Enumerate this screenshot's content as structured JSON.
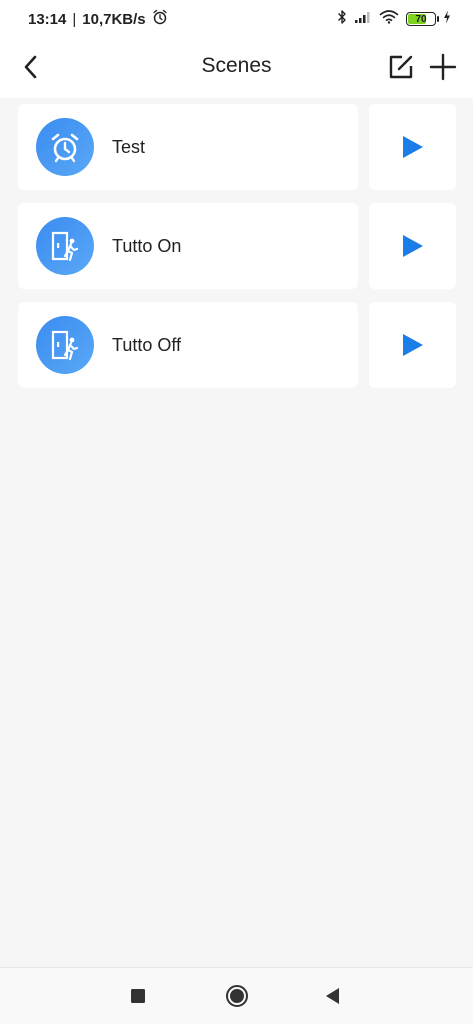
{
  "status_bar": {
    "time": "13:14",
    "separator": "|",
    "speed": "10,7KB/s",
    "battery_level": "70",
    "battery_fraction": 0.7,
    "icons": [
      "alarm-icon",
      "bluetooth-icon",
      "signal-icon",
      "wifi-icon",
      "battery-icon",
      "charging-icon"
    ]
  },
  "header": {
    "title": "Scenes",
    "back_icon": "chevron-left-icon",
    "edit_icon": "edit-icon",
    "add_icon": "plus-icon"
  },
  "scenes": [
    {
      "name": "Test",
      "icon": "alarm-clock-icon",
      "action_icon": "play-icon"
    },
    {
      "name": "Tutto On",
      "icon": "door-walk-icon",
      "action_icon": "play-icon"
    },
    {
      "name": "Tutto Off",
      "icon": "door-walk-icon",
      "action_icon": "play-icon"
    }
  ],
  "nav_bar": {
    "icons": [
      "recent-apps-icon",
      "home-icon",
      "back-icon"
    ]
  },
  "colors": {
    "accent": "#1a7de8",
    "icon_gradient_start": "#3a8cf0",
    "icon_gradient_end": "#5aa8f7",
    "background": "#f6f6f6",
    "card": "#ffffff",
    "battery_fill": "#7ed321"
  }
}
